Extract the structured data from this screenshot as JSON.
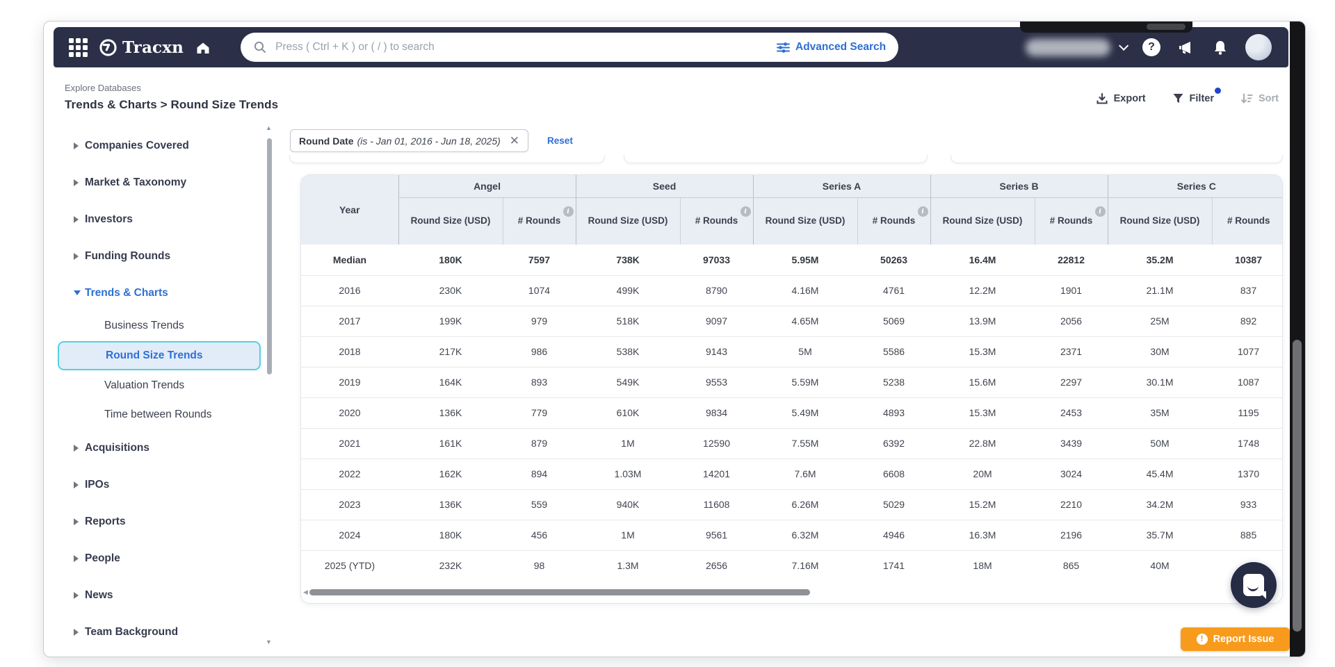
{
  "navbar": {
    "logo_text": "Tracxn",
    "search_placeholder": "Press ( Ctrl + K ) or ( / ) to search",
    "advanced_search_label": "Advanced Search"
  },
  "header": {
    "breadcrumb": "Explore Databases",
    "title": "Trends & Charts > Round Size Trends",
    "actions": {
      "export": "Export",
      "filter": "Filter",
      "sort": "Sort"
    }
  },
  "sidebar": {
    "items": [
      {
        "label": "Companies Covered",
        "type": "parent",
        "state": "collapsed"
      },
      {
        "label": "Market & Taxonomy",
        "type": "parent",
        "state": "collapsed"
      },
      {
        "label": "Investors",
        "type": "parent",
        "state": "collapsed"
      },
      {
        "label": "Funding Rounds",
        "type": "parent",
        "state": "collapsed"
      },
      {
        "label": "Trends & Charts",
        "type": "parent",
        "state": "expanded",
        "active": true
      },
      {
        "label": "Business Trends",
        "type": "child"
      },
      {
        "label": "Round Size Trends",
        "type": "child",
        "selected": true
      },
      {
        "label": "Valuation Trends",
        "type": "child"
      },
      {
        "label": "Time between Rounds",
        "type": "child"
      },
      {
        "label": "Acquisitions",
        "type": "parent",
        "state": "collapsed"
      },
      {
        "label": "IPOs",
        "type": "parent",
        "state": "collapsed"
      },
      {
        "label": "Reports",
        "type": "parent",
        "state": "collapsed"
      },
      {
        "label": "People",
        "type": "parent",
        "state": "collapsed"
      },
      {
        "label": "News",
        "type": "parent",
        "state": "collapsed"
      },
      {
        "label": "Team Background",
        "type": "parent",
        "state": "collapsed"
      }
    ]
  },
  "filters": {
    "chip_field": "Round Date",
    "chip_value": "(is - Jan 01, 2016 - Jun 18, 2025)",
    "reset_label": "Reset"
  },
  "chart_data": {
    "type": "table",
    "title": "Round Size Trends",
    "year_header": "Year",
    "groups": [
      "Angel",
      "Seed",
      "Series A",
      "Series B",
      "Series C"
    ],
    "sub_headers": [
      "Round Size (USD)",
      "# Rounds"
    ],
    "rows": [
      {
        "year": "Median",
        "bold": true,
        "values": [
          "180K",
          "7597",
          "738K",
          "97033",
          "5.95M",
          "50263",
          "16.4M",
          "22812",
          "35.2M",
          "10387"
        ]
      },
      {
        "year": "2016",
        "bold": false,
        "values": [
          "230K",
          "1074",
          "499K",
          "8790",
          "4.16M",
          "4761",
          "12.2M",
          "1901",
          "21.1M",
          "837"
        ]
      },
      {
        "year": "2017",
        "bold": false,
        "values": [
          "199K",
          "979",
          "518K",
          "9097",
          "4.65M",
          "5069",
          "13.9M",
          "2056",
          "25M",
          "892"
        ]
      },
      {
        "year": "2018",
        "bold": false,
        "values": [
          "217K",
          "986",
          "538K",
          "9143",
          "5M",
          "5586",
          "15.3M",
          "2371",
          "30M",
          "1077"
        ]
      },
      {
        "year": "2019",
        "bold": false,
        "values": [
          "164K",
          "893",
          "549K",
          "9553",
          "5.59M",
          "5238",
          "15.6M",
          "2297",
          "30.1M",
          "1087"
        ]
      },
      {
        "year": "2020",
        "bold": false,
        "values": [
          "136K",
          "779",
          "610K",
          "9834",
          "5.49M",
          "4893",
          "15.3M",
          "2453",
          "35M",
          "1195"
        ]
      },
      {
        "year": "2021",
        "bold": false,
        "values": [
          "161K",
          "879",
          "1M",
          "12590",
          "7.55M",
          "6392",
          "22.8M",
          "3439",
          "50M",
          "1748"
        ]
      },
      {
        "year": "2022",
        "bold": false,
        "values": [
          "162K",
          "894",
          "1.03M",
          "14201",
          "7.6M",
          "6608",
          "20M",
          "3024",
          "45.4M",
          "1370"
        ]
      },
      {
        "year": "2023",
        "bold": false,
        "values": [
          "136K",
          "559",
          "940K",
          "11608",
          "6.26M",
          "5029",
          "15.2M",
          "2210",
          "34.2M",
          "933"
        ]
      },
      {
        "year": "2024",
        "bold": false,
        "values": [
          "180K",
          "456",
          "1M",
          "9561",
          "6.32M",
          "4946",
          "16.3M",
          "2196",
          "35.7M",
          "885"
        ]
      },
      {
        "year": "2025 (YTD)",
        "bold": false,
        "values": [
          "232K",
          "98",
          "1.3M",
          "2656",
          "7.16M",
          "1741",
          "18M",
          "865",
          "40M",
          ""
        ]
      }
    ]
  },
  "footer": {
    "report_issue_label": "Report Issue"
  },
  "colors": {
    "navbar_bg": "#2b3048",
    "accent_blue": "#2e6fd4",
    "selection_cyan": "#54d0e0",
    "table_header_bg": "#e9edf4",
    "report_orange": "#f89b1c",
    "filter_dot_blue": "#1c49c9"
  }
}
